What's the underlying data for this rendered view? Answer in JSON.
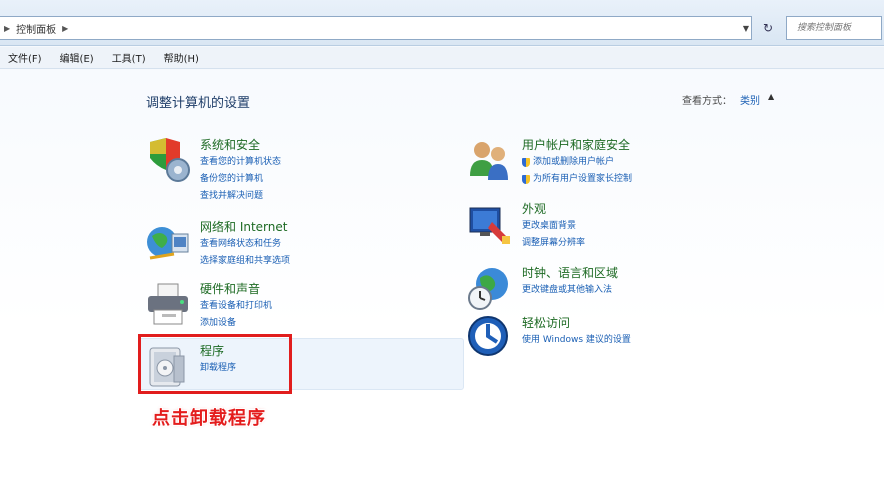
{
  "address_bar": {
    "path": "控制面板",
    "search_placeholder": "搜索控制面板"
  },
  "menu": {
    "items": [
      {
        "label": "文件(F)"
      },
      {
        "label": "编辑(E)"
      },
      {
        "label": "工具(T)"
      },
      {
        "label": "帮助(H)"
      }
    ]
  },
  "content": {
    "heading": "调整计算机的设置",
    "view_by_label": "查看方式：",
    "view_by_value": "类别"
  },
  "categories": {
    "system": {
      "title": "系统和安全",
      "links": [
        "查看您的计算机状态",
        "备份您的计算机",
        "查找并解决问题"
      ]
    },
    "network": {
      "title": "网络和 Internet",
      "links": [
        "查看网络状态和任务",
        "选择家庭组和共享选项"
      ]
    },
    "hardware": {
      "title": "硬件和声音",
      "links": [
        "查看设备和打印机",
        "添加设备"
      ]
    },
    "programs": {
      "title": "程序",
      "links": [
        "卸载程序"
      ]
    },
    "user_accounts": {
      "title": "用户帐户和家庭安全",
      "links": [
        "添加或删除用户帐户",
        "为所有用户设置家长控制"
      ]
    },
    "appearance": {
      "title": "外观",
      "links": [
        "更改桌面背景",
        "调整屏幕分辨率"
      ]
    },
    "clock": {
      "title": "时钟、语言和区域",
      "links": [
        "更改键盘或其他输入法"
      ]
    },
    "ease": {
      "title": "轻松访问",
      "links": [
        "使用 Windows 建议的设置"
      ]
    }
  },
  "annotation": {
    "text": "点击卸载程序",
    "color": "#e41d1d"
  }
}
